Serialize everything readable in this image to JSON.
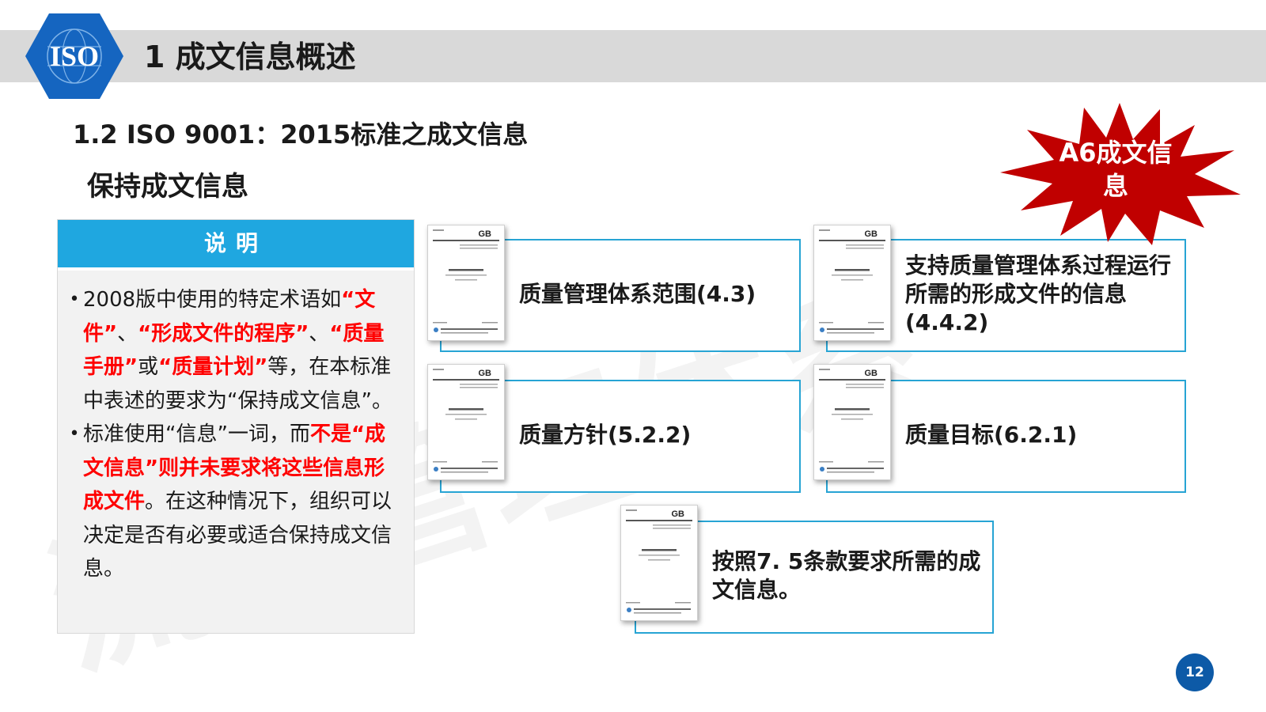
{
  "header": {
    "logo_text": "ISO",
    "title": "1 成文信息概述"
  },
  "subtitle": "1.2 ISO 9001：2015标准之成文信息",
  "section_label": "保持成文信息",
  "explanation": {
    "header": "说明",
    "bullet1": {
      "t1": "2008版中使用的特定术语如",
      "t2": "“文件”",
      "t3": "、",
      "t4": "“形成文件的程序”",
      "t5": "、",
      "t6": "“质量手册”",
      "t7": "或",
      "t8": "“质量计划”",
      "t9": "等，在本标准中表述的要求为“保持成文信息”。"
    },
    "bullet2": {
      "t1": "标准使用“信息”一词，而",
      "t2": "不是“成文信息”则并未要求将这些信息形成文件",
      "t3": "。在这种情况下，组织可以决定是否有必要或适合保持成文信息。"
    }
  },
  "cards": [
    {
      "label": "质量管理体系范围(4.3)"
    },
    {
      "label": "支持质量管理体系过程运行所需的形成文件的信息(4.4.2)"
    },
    {
      "label": "质量方针(5.2.2)"
    },
    {
      "label": "质量目标(6.2.1)"
    },
    {
      "label": "按照7. 5条款要求所需的成文信息。"
    }
  ],
  "doc_thumbnail": {
    "badge": "GB"
  },
  "burst": {
    "label": "A6成文信息",
    "color": "#c00000"
  },
  "watermark": "流程管理体系",
  "page_number": "12",
  "colors": {
    "accent_blue": "#1fa7e0",
    "card_border": "#27a4d4",
    "highlight_red": "#ff0000",
    "logo_blue": "#1565c0",
    "page_badge": "#0d5aa7"
  }
}
